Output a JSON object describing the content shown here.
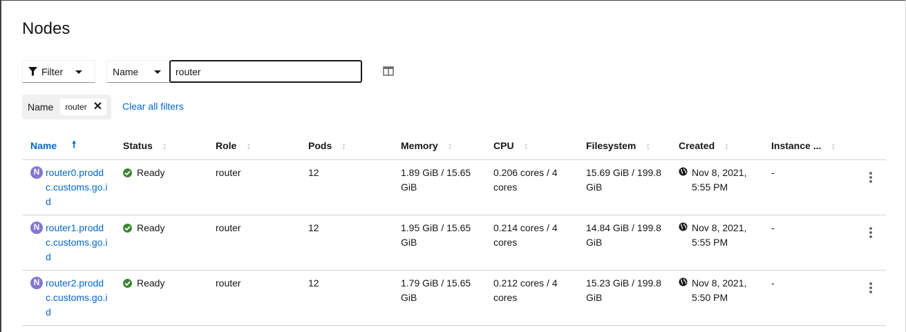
{
  "page": {
    "title": "Nodes"
  },
  "toolbar": {
    "filter_label": "Filter",
    "filter_by_label": "Name",
    "search_value": "router",
    "columns_icon": "manage-columns-icon"
  },
  "filters": {
    "chip_category": "Name",
    "chip_value": "router",
    "clear_all_label": "Clear all filters"
  },
  "table": {
    "columns": [
      "Name",
      "Status",
      "Role",
      "Pods",
      "Memory",
      "CPU",
      "Filesystem",
      "Created",
      "Instance ..."
    ],
    "rows": [
      {
        "badge": "N",
        "name": "router0.proddc.customs.go.id",
        "status": "Ready",
        "role": "router",
        "pods": "12",
        "memory": "1.89 GiB / 15.65 GiB",
        "cpu": "0.206 cores / 4 cores",
        "filesystem": "15.69 GiB / 199.8 GiB",
        "created": "Nov 8, 2021, 5:55 PM",
        "instance": "-"
      },
      {
        "badge": "N",
        "name": "router1.proddc.customs.go.id",
        "status": "Ready",
        "role": "router",
        "pods": "12",
        "memory": "1.95 GiB / 15.65 GiB",
        "cpu": "0.214 cores / 4 cores",
        "filesystem": "14.84 GiB / 199.8 GiB",
        "created": "Nov 8, 2021, 5:55 PM",
        "instance": "-"
      },
      {
        "badge": "N",
        "name": "router2.proddc.customs.go.id",
        "status": "Ready",
        "role": "router",
        "pods": "12",
        "memory": "1.79 GiB / 15.65 GiB",
        "cpu": "0.212 cores / 4 cores",
        "filesystem": "15.23 GiB / 199.8 GiB",
        "created": "Nov 8, 2021, 5:50 PM",
        "instance": "-"
      }
    ]
  },
  "colors": {
    "link": "#0066cc",
    "badge": "#8476d1",
    "status_ok": "#3e8635",
    "border": "#d2d2d2"
  }
}
